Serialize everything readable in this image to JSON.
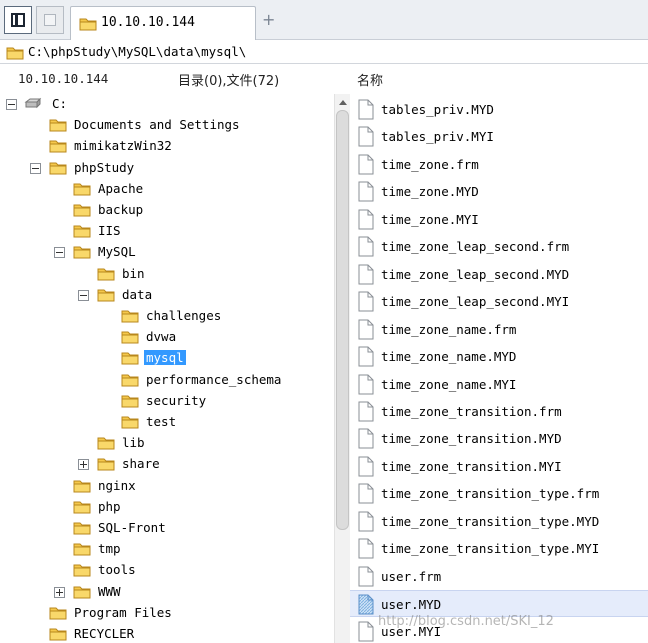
{
  "tabbar": {
    "tab_label": "10.10.10.144",
    "add_label": "+"
  },
  "pathbar": {
    "path": "C:\\phpStudy\\MySQL\\data\\mysql\\"
  },
  "headers": {
    "host": "10.10.10.144",
    "count": "目录(0),文件(72)",
    "name": "名称"
  },
  "tree": [
    {
      "label": "C:",
      "depth": 0,
      "toggle": "minus",
      "icon": "drive-icon"
    },
    {
      "label": "Documents and Settings",
      "depth": 1,
      "toggle": "none"
    },
    {
      "label": "mimikatzWin32",
      "depth": 1,
      "toggle": "none"
    },
    {
      "label": "phpStudy",
      "depth": 1,
      "toggle": "minus"
    },
    {
      "label": "Apache",
      "depth": 2,
      "toggle": "none"
    },
    {
      "label": "backup",
      "depth": 2,
      "toggle": "none"
    },
    {
      "label": "IIS",
      "depth": 2,
      "toggle": "none"
    },
    {
      "label": "MySQL",
      "depth": 2,
      "toggle": "minus"
    },
    {
      "label": "bin",
      "depth": 3,
      "toggle": "none"
    },
    {
      "label": "data",
      "depth": 3,
      "toggle": "minus"
    },
    {
      "label": "challenges",
      "depth": 4,
      "toggle": "none"
    },
    {
      "label": "dvwa",
      "depth": 4,
      "toggle": "none"
    },
    {
      "label": "mysql",
      "depth": 4,
      "toggle": "none",
      "selected": true
    },
    {
      "label": "performance_schema",
      "depth": 4,
      "toggle": "none"
    },
    {
      "label": "security",
      "depth": 4,
      "toggle": "none"
    },
    {
      "label": "test",
      "depth": 4,
      "toggle": "none"
    },
    {
      "label": "lib",
      "depth": 3,
      "toggle": "none"
    },
    {
      "label": "share",
      "depth": 3,
      "toggle": "plus"
    },
    {
      "label": "nginx",
      "depth": 2,
      "toggle": "none"
    },
    {
      "label": "php",
      "depth": 2,
      "toggle": "none"
    },
    {
      "label": "SQL-Front",
      "depth": 2,
      "toggle": "none"
    },
    {
      "label": "tmp",
      "depth": 2,
      "toggle": "none"
    },
    {
      "label": "tools",
      "depth": 2,
      "toggle": "none"
    },
    {
      "label": "WWW",
      "depth": 2,
      "toggle": "plus"
    },
    {
      "label": "Program Files",
      "depth": 1,
      "toggle": "none"
    },
    {
      "label": "RECYCLER",
      "depth": 1,
      "toggle": "none"
    }
  ],
  "files": [
    {
      "name": "tables_priv.MYD"
    },
    {
      "name": "tables_priv.MYI"
    },
    {
      "name": "time_zone.frm"
    },
    {
      "name": "time_zone.MYD"
    },
    {
      "name": "time_zone.MYI"
    },
    {
      "name": "time_zone_leap_second.frm"
    },
    {
      "name": "time_zone_leap_second.MYD"
    },
    {
      "name": "time_zone_leap_second.MYI"
    },
    {
      "name": "time_zone_name.frm"
    },
    {
      "name": "time_zone_name.MYD"
    },
    {
      "name": "time_zone_name.MYI"
    },
    {
      "name": "time_zone_transition.frm"
    },
    {
      "name": "time_zone_transition.MYD"
    },
    {
      "name": "time_zone_transition.MYI"
    },
    {
      "name": "time_zone_transition_type.frm"
    },
    {
      "name": "time_zone_transition_type.MYD"
    },
    {
      "name": "time_zone_transition_type.MYI"
    },
    {
      "name": "user.frm"
    },
    {
      "name": "user.MYD",
      "selected": true
    },
    {
      "name": "user.MYI"
    }
  ],
  "watermark": "http://blog.csdn.net/SKI_12",
  "colors": {
    "selection": "#3399ff",
    "folder": "#f3c14a",
    "row_selected": "#e5ecfb"
  }
}
